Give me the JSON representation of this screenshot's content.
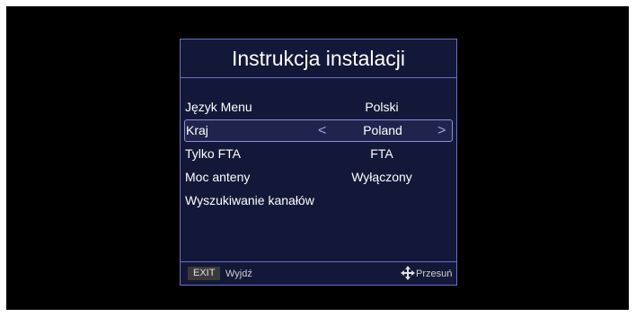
{
  "dialog": {
    "title": "Instrukcja instalacji",
    "rows": [
      {
        "label": "Język Menu",
        "value": "Polski"
      },
      {
        "label": "Kraj",
        "value": "Poland"
      },
      {
        "label": "Tylko FTA",
        "value": "FTA"
      },
      {
        "label": "Moc anteny",
        "value": "Wyłączony"
      },
      {
        "label": "Wyszukiwanie kanałów",
        "value": ""
      }
    ],
    "arrows": {
      "left": "<",
      "right": ">"
    }
  },
  "footer": {
    "exit_key": "EXIT",
    "exit_label": "Wyjdź",
    "move_icon": "move-arrows-icon",
    "move_label": "Przesuń"
  },
  "colors": {
    "panel_bg": "#141838",
    "border": "#6a6ec8",
    "highlight": "#8a8ee0"
  }
}
